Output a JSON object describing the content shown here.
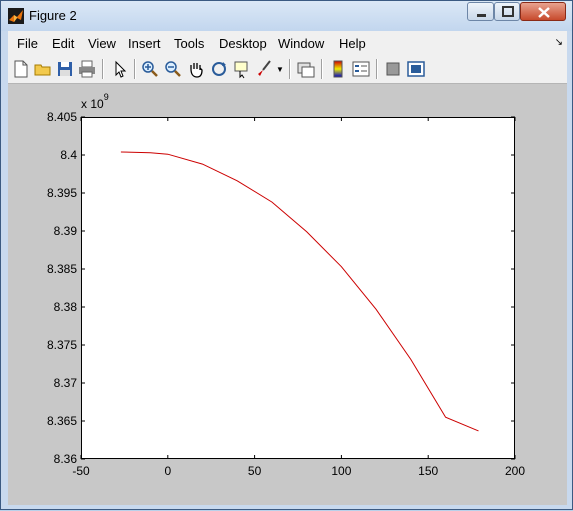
{
  "window": {
    "title": "Figure 2"
  },
  "menu": [
    "File",
    "Edit",
    "View",
    "Insert",
    "Tools",
    "Desktop",
    "Window",
    "Help"
  ],
  "menu_dock_icon": "dock-arrow-icon",
  "toolbar": [
    "new-figure-icon",
    "open-file-icon",
    "save-icon",
    "print-icon",
    "pointer-icon",
    "zoom-in-icon",
    "zoom-out-icon",
    "pan-icon",
    "rotate-3d-icon",
    "data-cursor-icon",
    "brush-icon",
    "link-plot-icon",
    "colorbar-icon",
    "legend-icon",
    "hide-plot-tools-icon",
    "show-plot-tools-icon"
  ],
  "axes": {
    "exponent_base": "x 10",
    "exponent_power": "9",
    "xticks": [
      "-50",
      "0",
      "50",
      "100",
      "150",
      "200"
    ],
    "yticks": [
      "8.405",
      "8.4",
      "8.395",
      "8.39",
      "8.385",
      "8.38",
      "8.375",
      "8.37",
      "8.365",
      "8.36"
    ]
  },
  "chart_data": {
    "type": "line",
    "title": "",
    "xlabel": "",
    "ylabel": "",
    "xlim": [
      -50,
      200
    ],
    "ylim": [
      8.36,
      8.405
    ],
    "y_exponent": 9,
    "grid": false,
    "color": "#cc0000",
    "series": [
      {
        "x": [
          -27,
          -10,
          0,
          20,
          40,
          60,
          80,
          100,
          120,
          140,
          160,
          179
        ],
        "y": [
          8.4004,
          8.4003,
          8.4001,
          8.3988,
          8.3966,
          8.3938,
          8.3899,
          8.3853,
          8.3797,
          8.3731,
          8.3655,
          8.3637
        ]
      }
    ]
  }
}
